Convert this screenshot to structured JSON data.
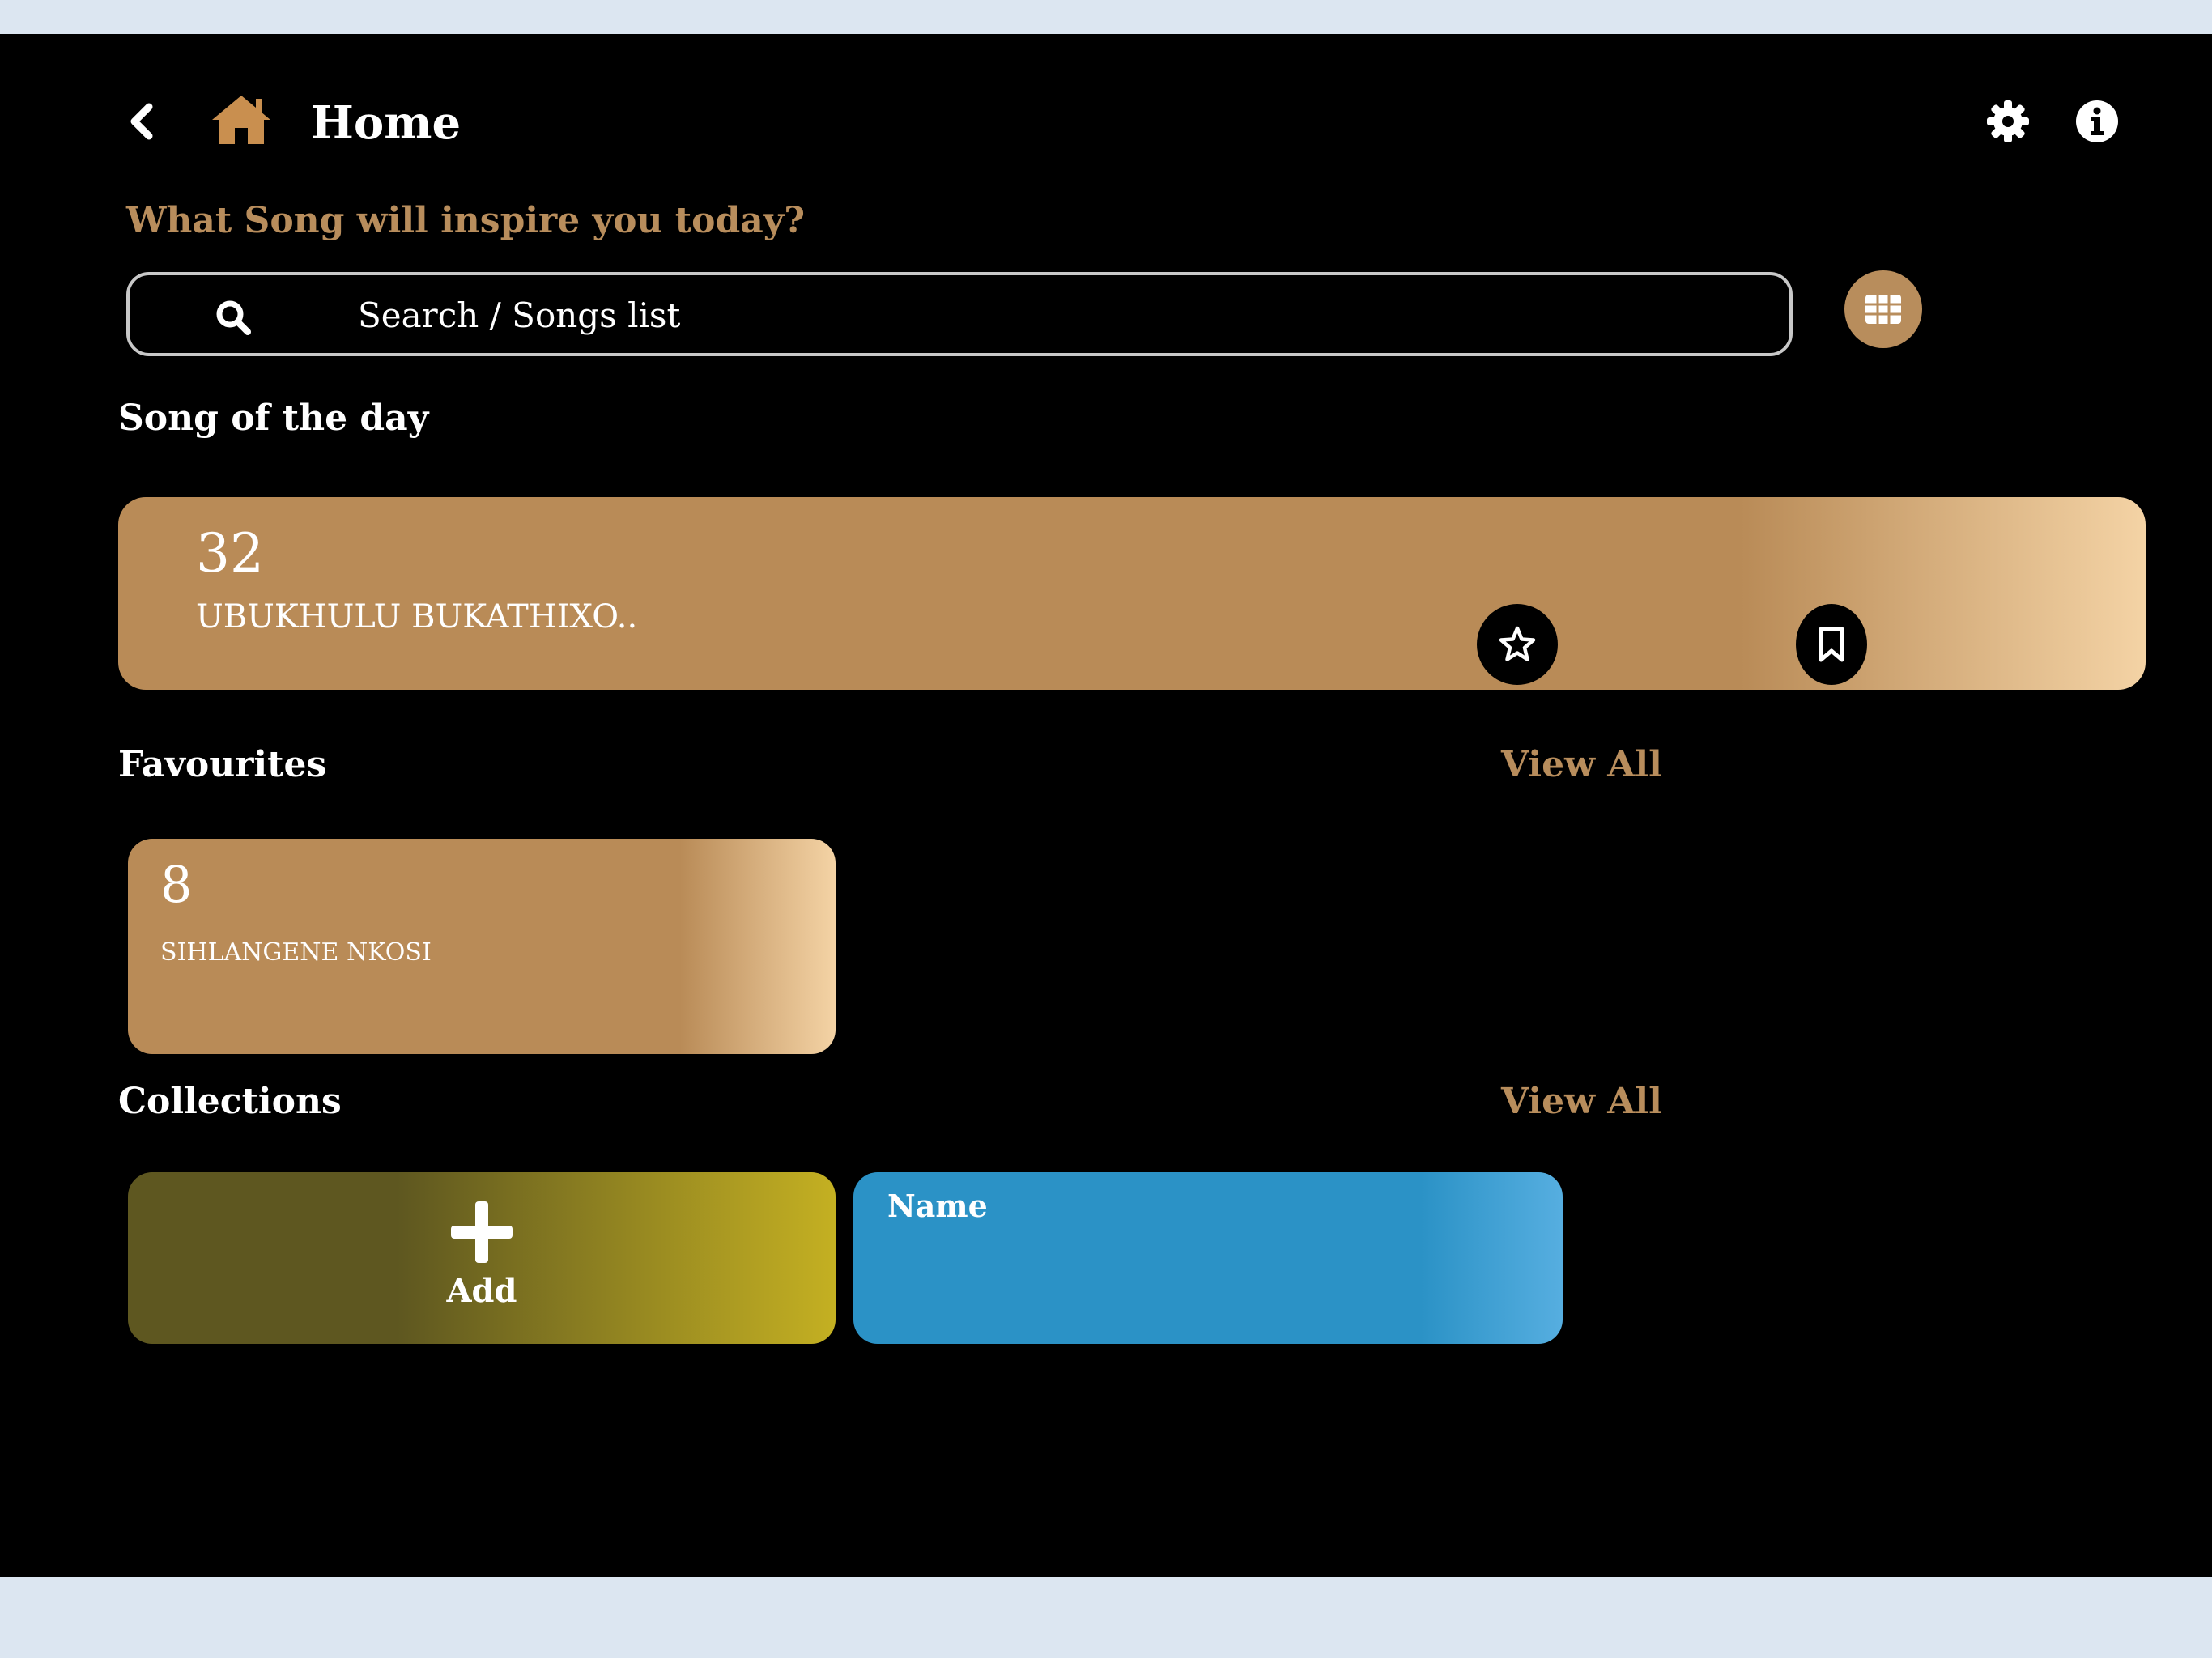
{
  "header": {
    "title": "Home",
    "icons": {
      "back": "chevron-left-icon",
      "home": "home-icon",
      "settings": "gear-icon",
      "info": "info-icon"
    }
  },
  "prompt": "What Song will inspire you today?",
  "search": {
    "placeholder": "Search / Songs list",
    "value": ""
  },
  "song_of_the_day": {
    "section_title": "Song of the day",
    "number": "32",
    "title": "UBUKHULU BUKATHIXO.."
  },
  "favourites": {
    "section_title": "Favourites",
    "view_all": "View All",
    "items": [
      {
        "number": "8",
        "title": "SIHLANGENE NKOSI"
      }
    ]
  },
  "collections": {
    "section_title": "Collections",
    "view_all": "View All",
    "add_label": "Add",
    "items": [
      {
        "name": "Name"
      }
    ]
  },
  "colors": {
    "accent": "#b88d5c",
    "card_light": "#f4d3a5",
    "add_card": "#5e5720",
    "collection_card": "#2b92c6",
    "background": "#000000",
    "page_bg": "#dce6f1"
  }
}
